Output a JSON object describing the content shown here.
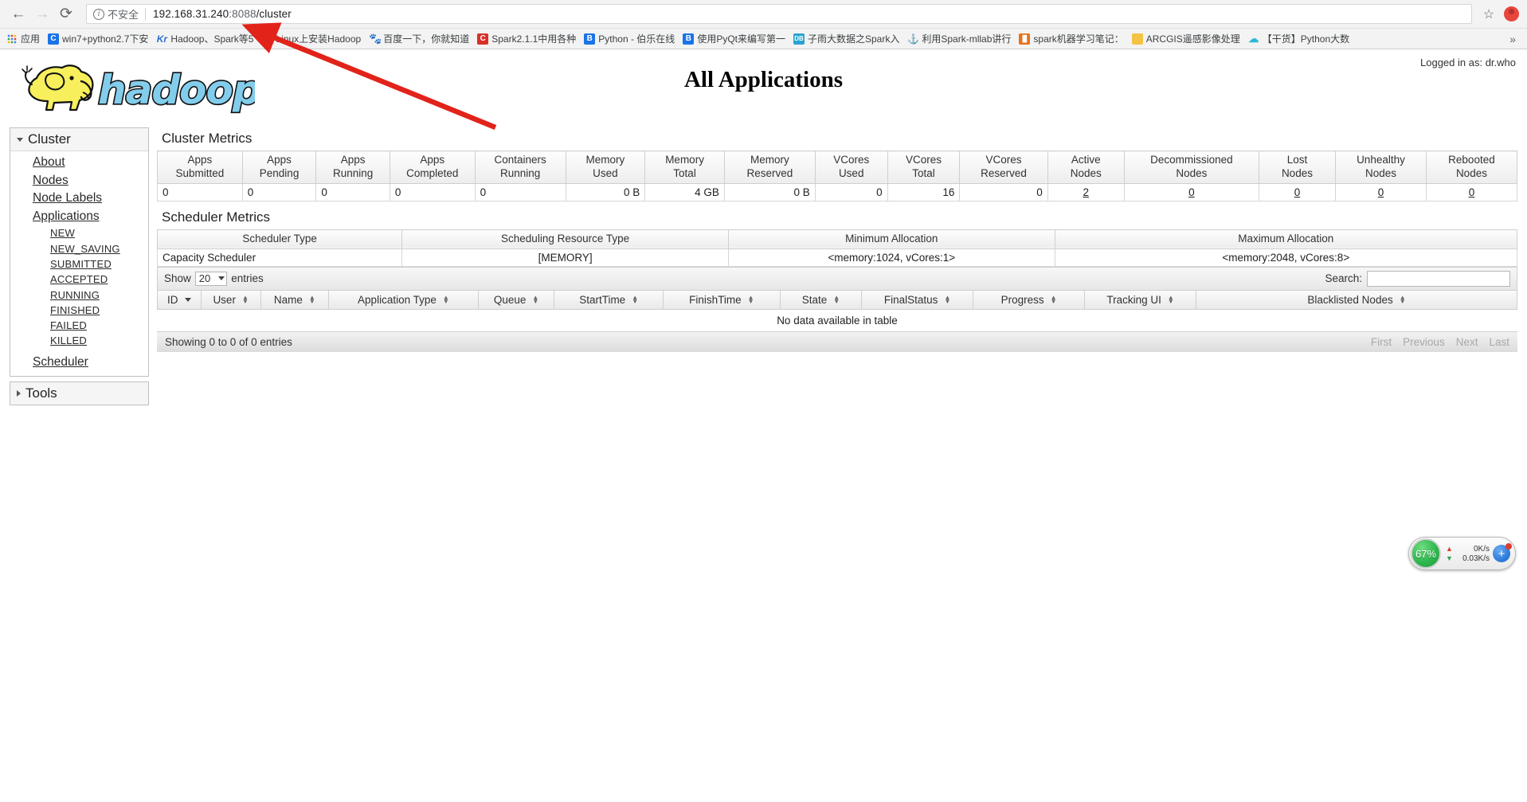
{
  "browser": {
    "back_icon": "back-arrow-icon",
    "forward_icon": "forward-arrow-icon",
    "reload_icon": "reload-icon",
    "security_label": "不安全",
    "url_host": "192.168.31.240",
    "url_port": ":8088",
    "url_path": "/cluster",
    "url_full": "192.168.31.240:8088/cluster",
    "star_icon": "bookmark-star-icon",
    "profile_icon": "profile-avatar-icon",
    "overflow_label": "»",
    "bookmarks": [
      {
        "label": "应用",
        "icon": "apps-grid-icon",
        "fav": "fav-apps"
      },
      {
        "label": "win7+python2.7下安",
        "icon": "bookmark-favicon",
        "fav": "fav-blue"
      },
      {
        "label": "Hadoop、Spark等5",
        "icon": "kr-favicon",
        "fav": "fav-kr"
      },
      {
        "label": "Linux上安装Hadoop",
        "icon": "csdn-favicon",
        "fav": "fav-red"
      },
      {
        "label": "百度一下，你就知道",
        "icon": "baidu-favicon",
        "fav": "fav-baidu"
      },
      {
        "label": "Spark2.1.1中用各种",
        "icon": "csdn-favicon",
        "fav": "fav-red"
      },
      {
        "label": "Python - 伯乐在线",
        "icon": "jobbole-favicon",
        "fav": "fav-blue"
      },
      {
        "label": "使用PyQt来编写第一",
        "icon": "jobbole-favicon",
        "fav": "fav-blue"
      },
      {
        "label": "子雨大数据之Spark入",
        "icon": "db-favicon",
        "fav": "fav-cyan"
      },
      {
        "label": "利用Spark-mllab讲行",
        "icon": "anchor-favicon",
        "fav": "fav-anchor"
      },
      {
        "label": "spark机器学习笔记：",
        "icon": "orange-favicon",
        "fav": "fav-orange"
      },
      {
        "label": "ARCGIS遥感影像处理",
        "icon": "folder-icon",
        "fav": "fav-folder"
      },
      {
        "label": "【干货】Python大数",
        "icon": "cloud-favicon",
        "fav": "fav-teal"
      }
    ]
  },
  "yarn": {
    "logo_alt": "hadoop-logo",
    "page_title": "All Applications",
    "logged_in": "Logged in as: dr.who"
  },
  "sidebar": {
    "cluster_group": {
      "label": "Cluster",
      "expanded": true,
      "links": [
        {
          "label": "About"
        },
        {
          "label": "Nodes"
        },
        {
          "label": "Node Labels"
        },
        {
          "label": "Applications"
        }
      ],
      "app_states": [
        {
          "label": "NEW"
        },
        {
          "label": "NEW_SAVING"
        },
        {
          "label": "SUBMITTED"
        },
        {
          "label": "ACCEPTED"
        },
        {
          "label": "RUNNING"
        },
        {
          "label": "FINISHED"
        },
        {
          "label": "FAILED"
        },
        {
          "label": "KILLED"
        }
      ],
      "scheduler_link": {
        "label": "Scheduler"
      }
    },
    "tools_group": {
      "label": "Tools",
      "expanded": false
    }
  },
  "cluster_metrics": {
    "title": "Cluster Metrics",
    "headers": [
      {
        "line1": "Apps",
        "line2": "Submitted"
      },
      {
        "line1": "Apps",
        "line2": "Pending"
      },
      {
        "line1": "Apps",
        "line2": "Running"
      },
      {
        "line1": "Apps",
        "line2": "Completed"
      },
      {
        "line1": "Containers",
        "line2": "Running"
      },
      {
        "line1": "Memory",
        "line2": "Used"
      },
      {
        "line1": "Memory",
        "line2": "Total"
      },
      {
        "line1": "Memory",
        "line2": "Reserved"
      },
      {
        "line1": "VCores",
        "line2": "Used"
      },
      {
        "line1": "VCores",
        "line2": "Total"
      },
      {
        "line1": "VCores",
        "line2": "Reserved"
      },
      {
        "line1": "Active",
        "line2": "Nodes"
      },
      {
        "line1": "Decommissioned",
        "line2": "Nodes"
      },
      {
        "line1": "Lost",
        "line2": "Nodes"
      },
      {
        "line1": "Unhealthy",
        "line2": "Nodes"
      },
      {
        "line1": "Rebooted",
        "line2": "Nodes"
      }
    ],
    "values": [
      "0",
      "0",
      "0",
      "0",
      "0",
      "0 B",
      "4 GB",
      "0 B",
      "0",
      "16",
      "0",
      "2",
      "0",
      "0",
      "0",
      "0"
    ]
  },
  "scheduler_metrics": {
    "title": "Scheduler Metrics",
    "headers": [
      "Scheduler Type",
      "Scheduling Resource Type",
      "Minimum Allocation",
      "Maximum Allocation"
    ],
    "row": [
      "Capacity Scheduler",
      "[MEMORY]",
      "<memory:1024, vCores:1>",
      "<memory:2048, vCores:8>"
    ]
  },
  "apps_table": {
    "show_label": "Show",
    "entries_count": "20",
    "entries_label": "entries",
    "search_label": "Search:",
    "search_value": "",
    "search_placeholder": "",
    "headers": [
      "ID",
      "User",
      "Name",
      "Application Type",
      "Queue",
      "StartTime",
      "FinishTime",
      "State",
      "FinalStatus",
      "Progress",
      "Tracking UI",
      "Blacklisted Nodes"
    ],
    "no_data": "No data available in table",
    "showing": "Showing 0 to 0 of 0 entries",
    "pager": [
      "First",
      "Previous",
      "Next",
      "Last"
    ]
  },
  "speed_widget": {
    "cpu_percent": "67%",
    "upload": "0K/s",
    "download": "0.03K/s",
    "up_icon": "arrow-up-icon",
    "down_icon": "arrow-down-icon",
    "plus_icon": "plus-icon"
  },
  "colors": {
    "arrow_red": "#e2231a",
    "hadoop_yellow": "#f5e642",
    "hadoop_blue": "#7ecbee",
    "accent_blue": "#1a73e8"
  }
}
